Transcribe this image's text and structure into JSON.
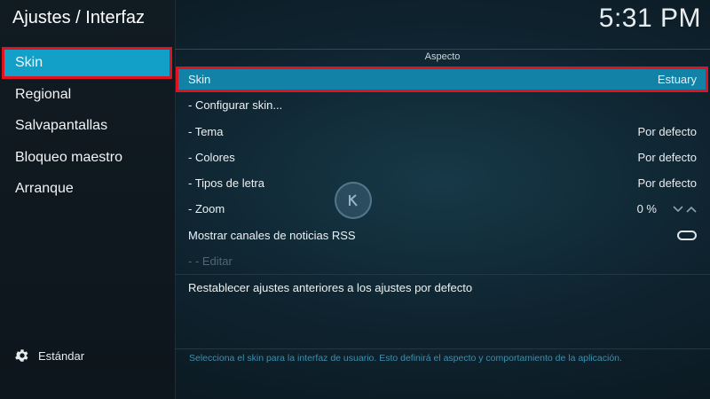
{
  "window": {
    "title": "Ajustes / Interfaz",
    "clock": "5:31 PM"
  },
  "sidebar": {
    "items": [
      {
        "label": "Skin",
        "selected": true
      },
      {
        "label": "Regional"
      },
      {
        "label": "Salvapantallas"
      },
      {
        "label": "Bloqueo maestro"
      },
      {
        "label": "Arranque"
      }
    ],
    "footer": {
      "icon": "gear-icon",
      "label": "Estándar"
    }
  },
  "main": {
    "section_title": "Aspecto",
    "rows": [
      {
        "label": "Skin",
        "value": "Estuary",
        "selected": true
      },
      {
        "label": "- Configurar skin...",
        "value": ""
      },
      {
        "label": "- Tema",
        "value": "Por defecto"
      },
      {
        "label": "- Colores",
        "value": "Por defecto"
      },
      {
        "label": "- Tipos de letra",
        "value": "Por defecto"
      },
      {
        "label": "- Zoom",
        "value": "0 %"
      },
      {
        "label": "Mostrar canales de noticias RSS",
        "value": ""
      },
      {
        "label": "- - Editar",
        "value": "",
        "disabled": true
      }
    ],
    "reset_label": "Restablecer ajustes anteriores a los ajustes por defecto",
    "help_text": "Selecciona el skin para la interfaz de usuario. Esto definirá el aspecto y comportamiento de la aplicación."
  },
  "colors": {
    "accent": "#12a0c8",
    "highlight_border": "#e0131e",
    "help_text": "#3d90ad"
  }
}
